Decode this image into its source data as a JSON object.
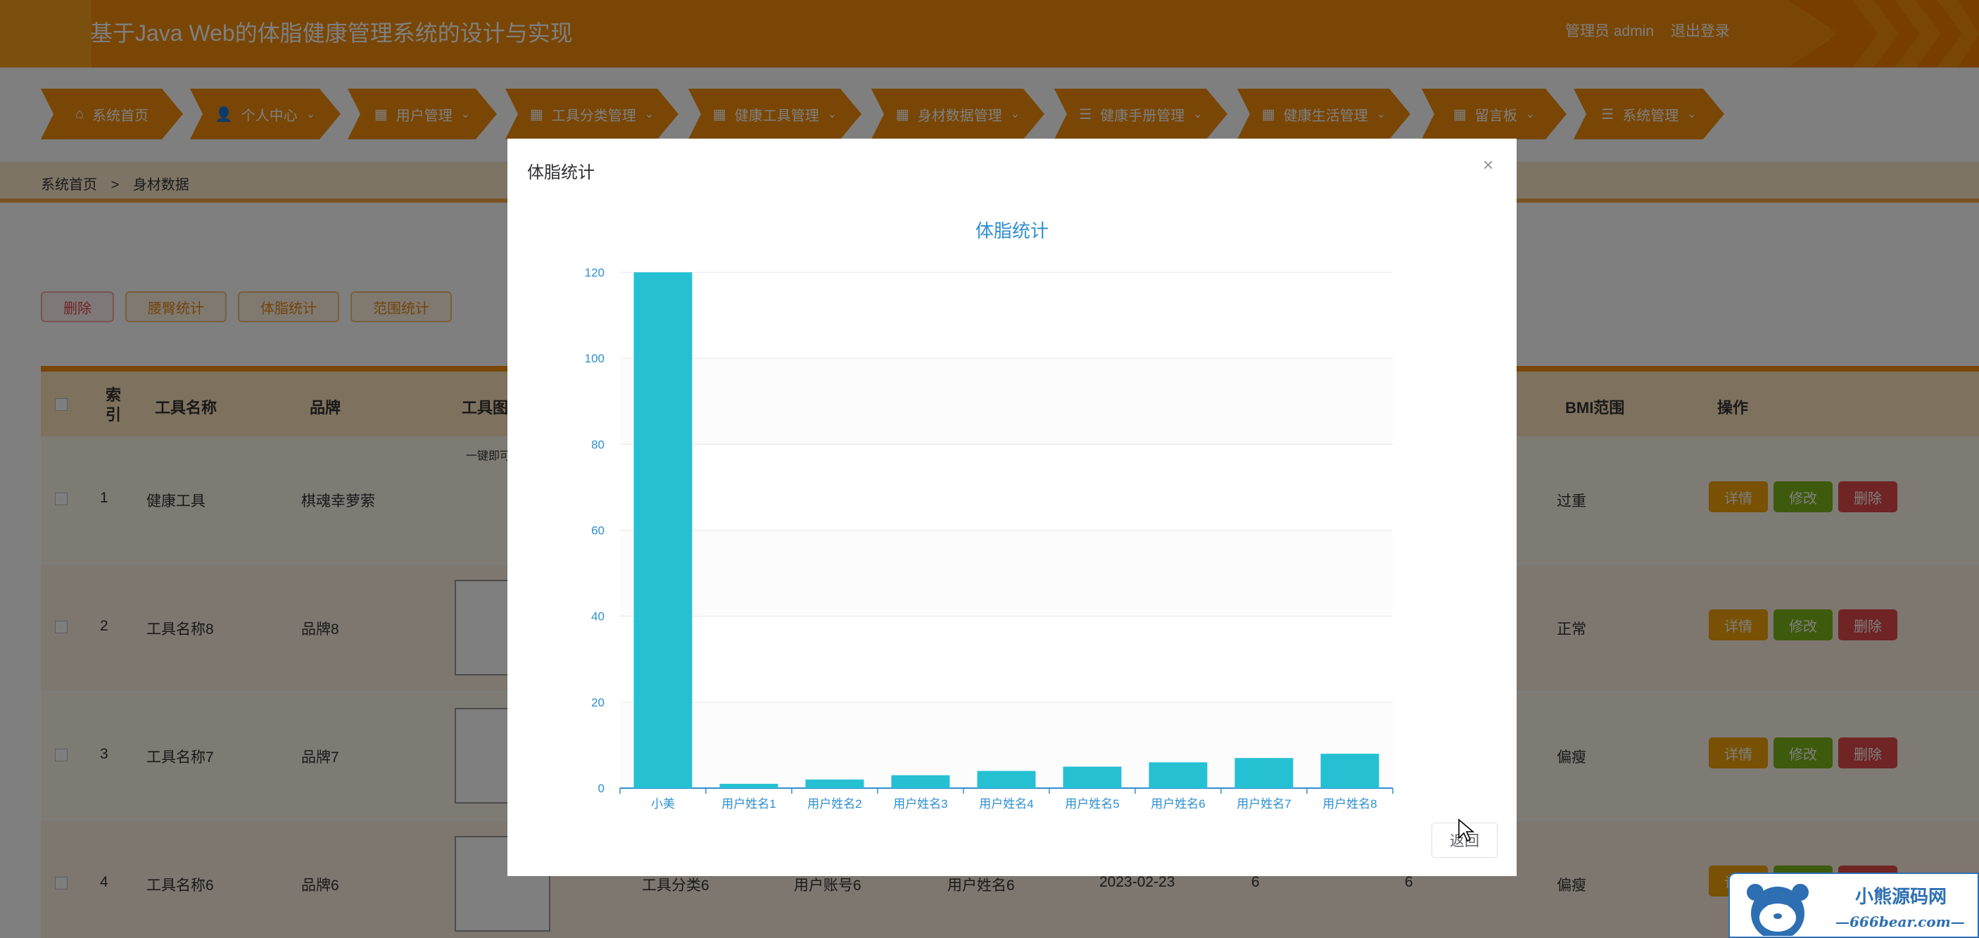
{
  "header": {
    "title": "基于Java Web的体脂健康管理系统的设计与实现",
    "user_role": "管理员 admin",
    "logout": "退出登录"
  },
  "nav": [
    {
      "label": "系统首页",
      "icon": "home-icon",
      "glyph": "⌂",
      "has_menu": false
    },
    {
      "label": "个人中心",
      "icon": "user-icon",
      "glyph": "👤",
      "has_menu": true
    },
    {
      "label": "用户管理",
      "icon": "grid-icon",
      "glyph": "▦",
      "has_menu": true
    },
    {
      "label": "工具分类管理",
      "icon": "grid-icon",
      "glyph": "▦",
      "has_menu": true
    },
    {
      "label": "健康工具管理",
      "icon": "grid-icon",
      "glyph": "▦",
      "has_menu": true
    },
    {
      "label": "身材数据管理",
      "icon": "table-icon",
      "glyph": "▦",
      "has_menu": true
    },
    {
      "label": "健康手册管理",
      "icon": "list-icon",
      "glyph": "☰",
      "has_menu": true
    },
    {
      "label": "健康生活管理",
      "icon": "grid-icon",
      "glyph": "▦",
      "has_menu": true
    },
    {
      "label": "留言板",
      "icon": "grid-icon",
      "glyph": "▦",
      "has_menu": true
    },
    {
      "label": "系统管理",
      "icon": "list-icon",
      "glyph": "☰",
      "has_menu": true
    }
  ],
  "breadcrumb": {
    "home": "系统首页",
    "sep": ">",
    "current": "身材数据"
  },
  "actions": {
    "delete": "删除",
    "waist_stats": "腰臀统计",
    "bodyfat_stats": "体脂统计",
    "range_stats": "范围统计"
  },
  "table": {
    "headers": {
      "index": "索引",
      "tool_name": "工具名称",
      "brand": "品牌",
      "tool_image": "工具图片",
      "bmi_range": "BMI范围",
      "ops": "操作"
    },
    "rows": [
      {
        "index": "1",
        "tool_name": "健康工具",
        "brand": "棋魂幸萝萦",
        "bmi_range": "过重"
      },
      {
        "index": "2",
        "tool_name": "工具名称8",
        "brand": "品牌8",
        "bmi_range": "正常"
      },
      {
        "index": "3",
        "tool_name": "工具名称7",
        "brand": "品牌7",
        "bmi_range": "偏瘦"
      },
      {
        "index": "4",
        "tool_name": "工具名称6",
        "brand": "品牌6",
        "category": "工具分类6",
        "account": "用户账号6",
        "username": "用户姓名6",
        "date": "2023-02-23",
        "v1": "6",
        "v2": "6",
        "bmi_range": "偏瘦"
      }
    ],
    "row_buttons": {
      "detail": "详情",
      "edit": "修改",
      "delete": "删除"
    },
    "image_caption": "一键即可"
  },
  "modal": {
    "title": "体脂统计",
    "close": "×",
    "back": "返回"
  },
  "chart_data": {
    "type": "bar",
    "title": "体脂统计",
    "categories": [
      "小美",
      "用户姓名1",
      "用户姓名2",
      "用户姓名3",
      "用户姓名4",
      "用户姓名5",
      "用户姓名6",
      "用户姓名7",
      "用户姓名8"
    ],
    "values": [
      120,
      1,
      2,
      3,
      4,
      5,
      6,
      7,
      8
    ],
    "ylim": [
      0,
      120
    ],
    "yticks": [
      0,
      20,
      40,
      60,
      80,
      100,
      120
    ],
    "grid": true,
    "color": "#26c0d3"
  },
  "watermark": {
    "name": "小熊源码网",
    "url": "—666bear.com—"
  },
  "colors": {
    "primary": "#f28c0a",
    "accent": "#f6a01e",
    "bar": "#26c0d3",
    "title_blue": "#2f8fd0"
  }
}
